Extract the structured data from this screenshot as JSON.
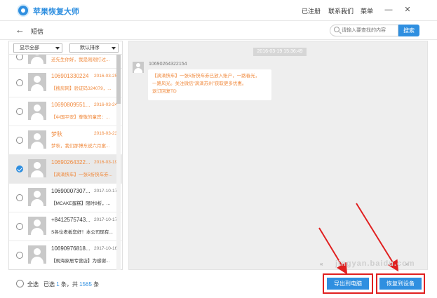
{
  "app": {
    "title": "苹果恢复大师",
    "links": [
      "已注册",
      "联系我们",
      "菜单"
    ],
    "win_minimize": "—",
    "win_close": "✕"
  },
  "header": {
    "title": "短信",
    "search_placeholder": "请输入要查找的内容",
    "search_button": "搜索"
  },
  "filters": {
    "show": "显示全部",
    "sort": "默认排序"
  },
  "messages": [
    {
      "name": "",
      "date": "",
      "preview": "还先生你好，我是刚刚打过...",
      "style": "orange",
      "selected": false
    },
    {
      "name": "106901330224",
      "date": "2016-03-25",
      "preview": "【搜房网】验证码324079，...",
      "style": "orange",
      "selected": false
    },
    {
      "name": "10690809551...",
      "date": "2016-03-24",
      "preview": "【中国平安】尊敬的童宾：...",
      "style": "orange",
      "selected": false
    },
    {
      "name": "梦秋",
      "date": "2016-03-23",
      "preview": "梦秋，我们那博东说六月案...",
      "style": "orange",
      "selected": false
    },
    {
      "name": "10690264322...",
      "date": "2016-03-19",
      "preview": "【滴滴快车】一张5折快车券...",
      "style": "orange",
      "selected": true
    },
    {
      "name": "10690007307...",
      "date": "2017-10-17",
      "preview": "【MCAKE蛋糕】限时8折，...",
      "style": "dark",
      "selected": false
    },
    {
      "name": "+8412575743...",
      "date": "2017-10-17",
      "preview": "S各位老板您好！本公司现有...",
      "style": "dark",
      "selected": false
    },
    {
      "name": "10690976818...",
      "date": "2017-10-16",
      "preview": "【观海家居专营店】为感谢...",
      "style": "dark",
      "selected": false
    }
  ],
  "conversation": {
    "time": "2016-03-19 15:36:49",
    "sender": "10690264322154",
    "bubble_lines": [
      "【滴滴快车】一张5折快车券已放入账户，一路春光，",
      "一路风光。关注微信“滴滴苏州”获取更多优惠。",
      "退订回复TD"
    ]
  },
  "pager": {
    "prev": "«",
    "next": "»"
  },
  "bottom": {
    "select_all": "全选",
    "selected_prefix": "已选",
    "selected_count": "1",
    "selected_unit": "条，共",
    "total_count": "1565",
    "total_unit": "条",
    "btn_export": "导出到电脑",
    "btn_recover": "恢复到设备"
  },
  "watermark": "jingyan.baidu.com",
  "colors": {
    "accent": "#2f8fe0",
    "orange_text": "#f08a3e",
    "highlight_red": "#e02020"
  }
}
